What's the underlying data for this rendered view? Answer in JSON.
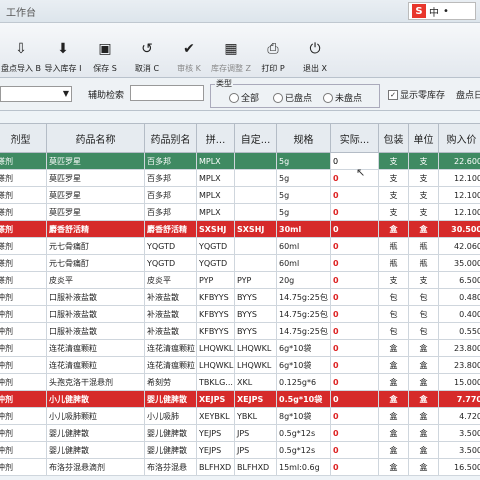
{
  "window": {
    "title": "工作台"
  },
  "ime": {
    "badge": "S",
    "mode": "中",
    "symbols": "•"
  },
  "toolbar": [
    {
      "icon": "import-icon",
      "glyph": "⇩",
      "label": "盘点导入 B",
      "enabled": true
    },
    {
      "icon": "download-icon",
      "glyph": "⬇",
      "label": "导入库存 I",
      "enabled": true
    },
    {
      "icon": "save-icon",
      "glyph": "▣",
      "label": "保存 S",
      "enabled": true
    },
    {
      "icon": "undo-icon",
      "glyph": "↺",
      "label": "取消 C",
      "enabled": true
    },
    {
      "icon": "audit-icon",
      "glyph": "✔",
      "label": "审核 K",
      "enabled": false
    },
    {
      "icon": "adjust-icon",
      "glyph": "▦",
      "label": "库存调整 Z",
      "enabled": false
    },
    {
      "icon": "print-icon",
      "glyph": "⎙",
      "label": "打印 P",
      "enabled": true
    },
    {
      "icon": "exit-icon",
      "glyph": "⏻",
      "label": "退出 X",
      "enabled": true
    }
  ],
  "filters": {
    "aux_search_label": "辅助检索",
    "type_group_title": "类型",
    "radios": [
      "全部",
      "已盘点",
      "未盘点"
    ],
    "show_zero_label": "显示零库存",
    "extra_label": "盘点日"
  },
  "table": {
    "headers": [
      "剂型",
      "药品名称",
      "药品别名",
      "拼...",
      "自定...",
      "规格",
      "实际...",
      "包装",
      "单位",
      "购入价"
    ],
    "rows": [
      {
        "style": "sel",
        "cells": [
          "搽剂",
          "莫匹罗星",
          "百多邦",
          "MPLX",
          "",
          "5g",
          "0",
          "支",
          "支",
          "22.600"
        ]
      },
      {
        "style": "",
        "cells": [
          "搽剂",
          "莫匹罗星",
          "百多邦",
          "MPLX",
          "",
          "5g",
          "0",
          "支",
          "支",
          "12.100"
        ]
      },
      {
        "style": "",
        "cells": [
          "搽剂",
          "莫匹罗星",
          "百多邦",
          "MPLX",
          "",
          "5g",
          "0",
          "支",
          "支",
          "12.100"
        ]
      },
      {
        "style": "",
        "cells": [
          "搽剂",
          "莫匹罗星",
          "百多邦",
          "MPLX",
          "",
          "5g",
          "0",
          "支",
          "支",
          "12.100"
        ]
      },
      {
        "style": "red",
        "cells": [
          "搽剂",
          "麝香舒活精",
          "麝香舒活精",
          "SXSHJ",
          "SXSHJ",
          "30ml",
          "0",
          "盒",
          "盒",
          "30.500"
        ]
      },
      {
        "style": "",
        "cells": [
          "搽剂",
          "元七骨痛酊",
          "YQGTD",
          "YQGTD",
          "",
          "60ml",
          "0",
          "瓶",
          "瓶",
          "42.060"
        ]
      },
      {
        "style": "",
        "cells": [
          "搽剂",
          "元七骨痛酊",
          "YQGTD",
          "YQGTD",
          "",
          "60ml",
          "0",
          "瓶",
          "瓶",
          "35.000"
        ]
      },
      {
        "style": "",
        "cells": [
          "搽剂",
          "皮炎平",
          "皮炎平",
          "PYP",
          "PYP",
          "20g",
          "0",
          "支",
          "支",
          "6.500"
        ]
      },
      {
        "style": "",
        "cells": [
          "冲剂",
          "口服补液盐散",
          "补液盐散",
          "KFBYYS",
          "BYYS",
          "14.75g:25包",
          "0",
          "包",
          "包",
          "0.480"
        ]
      },
      {
        "style": "",
        "cells": [
          "冲剂",
          "口服补液盐散",
          "补液盐散",
          "KFBYYS",
          "BYYS",
          "14.75g:25包",
          "0",
          "包",
          "包",
          "0.400"
        ]
      },
      {
        "style": "",
        "cells": [
          "冲剂",
          "口服补液盐散",
          "补液盐散",
          "KFBYYS",
          "BYYS",
          "14.75g:25包",
          "0",
          "包",
          "包",
          "0.550"
        ]
      },
      {
        "style": "",
        "cells": [
          "冲剂",
          "连花清瘟颗粒",
          "连花清瘟颗粒",
          "LHQWKL",
          "LHQWKL",
          "6g*10袋",
          "0",
          "盒",
          "盒",
          "23.800"
        ]
      },
      {
        "style": "",
        "cells": [
          "冲剂",
          "连花清瘟颗粒",
          "连花清瘟颗粒",
          "LHQWKL",
          "LHQWKL",
          "6g*10袋",
          "0",
          "盒",
          "盒",
          "23.800"
        ]
      },
      {
        "style": "",
        "cells": [
          "冲剂",
          "头孢克洛干混悬剂",
          "希刻劳",
          "TBKLG...",
          "XKL",
          "0.125g*6",
          "0",
          "盒",
          "盒",
          "15.000"
        ]
      },
      {
        "style": "red",
        "cells": [
          "冲剂",
          "小儿健脾散",
          "婴儿健脾散",
          "XEJPS",
          "XEJPS",
          "0.5g*10袋",
          "0",
          "盒",
          "盒",
          "7.770"
        ]
      },
      {
        "style": "",
        "cells": [
          "冲剂",
          "小儿吸肺颗粒",
          "小儿吸肺",
          "XEYBKL",
          "YBKL",
          "8g*10袋",
          "0",
          "盒",
          "盒",
          "4.720"
        ]
      },
      {
        "style": "",
        "cells": [
          "冲剂",
          "婴儿健脾散",
          "婴儿健脾散",
          "YEJPS",
          "JPS",
          "0.5g*12s",
          "0",
          "盒",
          "盒",
          "3.500"
        ]
      },
      {
        "style": "",
        "cells": [
          "冲剂",
          "婴儿健脾散",
          "婴儿健脾散",
          "YEJPS",
          "JPS",
          "0.5g*12s",
          "0",
          "盒",
          "盒",
          "3.500"
        ]
      },
      {
        "style": "",
        "cells": [
          "冲剂",
          "布洛芬混悬滴剂",
          "布洛芬混悬",
          "BLFHXD",
          "BLFHXD",
          "15ml:0.6g",
          "0",
          "盒",
          "盒",
          "16.500"
        ]
      }
    ]
  }
}
